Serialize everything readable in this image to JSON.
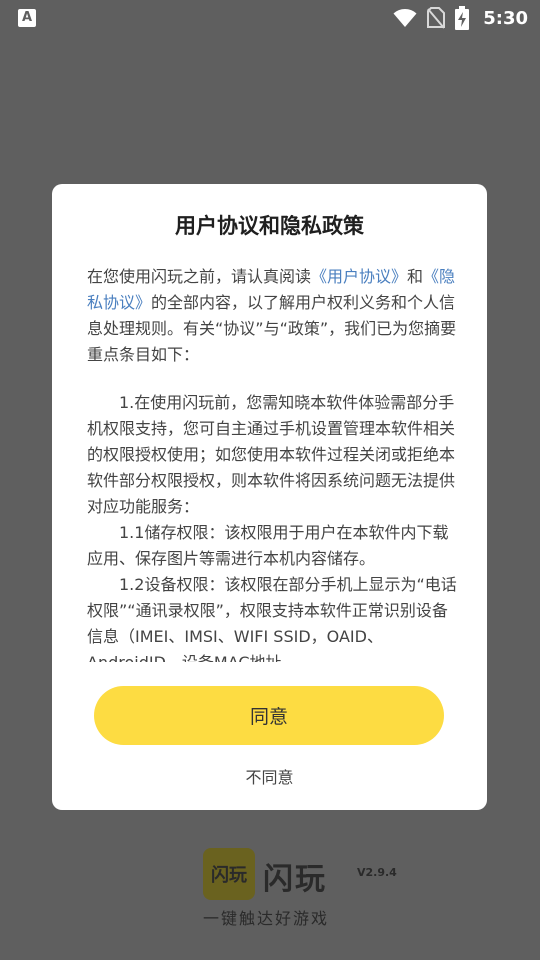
{
  "status_bar": {
    "notification_icon_text": "A",
    "time": "5:30"
  },
  "dialog": {
    "title": "用户协议和隐私政策",
    "intro": {
      "p1_a": "在您使用闪玩之前，请认真阅读",
      "link_user_agreement": "《用户协议》",
      "p1_b": "和",
      "link_privacy": "《隐私协议》",
      "p1_c": "的全部内容，以了解用户权利义务和个人信息处理规则。有关“协议”与“政策”，我们已为您摘要重点条目如下："
    },
    "item_1": "1.在使用闪玩前，您需知晓本软件体验需部分手机权限支持，您可自主通过手机设置管理本软件相关的权限授权使用；如您使用本软件过程关闭或拒绝本软件部分权限授权，则本软件将因系统问题无法提供对应功能服务：",
    "item_1_1": "1.1储存权限：该权限用于用户在本软件内下载应用、保存图片等需进行本机内容储存。",
    "item_1_2": "1.2设备权限：该权限在部分手机上显示为“电话权限”“通讯录权限”，权限支持本软件正常识别设备信息（IMEI、IMSI、WIFI SSID，OAID、AndroidID、设备MAC地址、",
    "agree_label": "同意",
    "disagree_label": "不同意"
  },
  "brand": {
    "logo_text": "闪玩",
    "name": "闪玩",
    "version": "V2.9.4",
    "slogan": "一键触达好游戏"
  }
}
